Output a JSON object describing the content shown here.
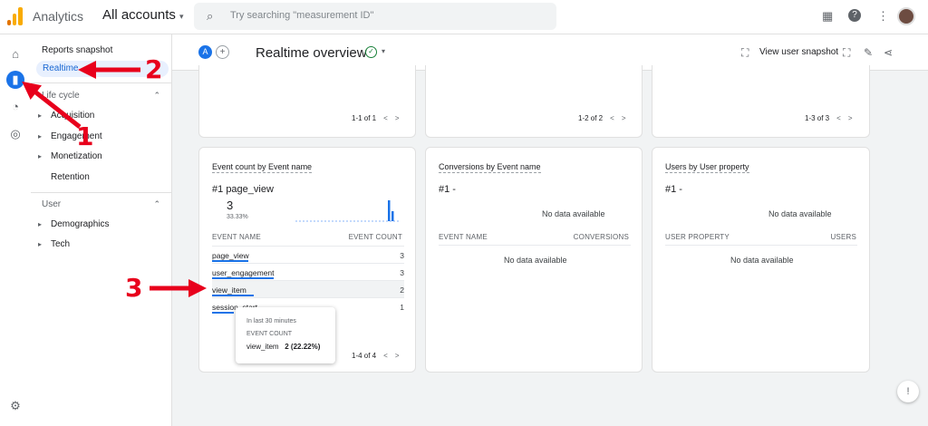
{
  "header": {
    "app_name": "Analytics",
    "accounts": "All accounts",
    "search_placeholder": "Try searching \"measurement ID\""
  },
  "sidebar": {
    "reports_snapshot": "Reports snapshot",
    "realtime": "Realtime",
    "life_cycle": "Life cycle",
    "life_cycle_items": [
      "Acquisition",
      "Engagement",
      "Monetization",
      "Retention"
    ],
    "user": "User",
    "user_items": [
      "Demographics",
      "Tech"
    ]
  },
  "toolbar": {
    "chip": "A",
    "title": "Realtime overview",
    "view_snapshot": "View user snapshot"
  },
  "top_cards": [
    {
      "pager": "1-1 of 1"
    },
    {
      "pager": "1-2 of 2"
    },
    {
      "pager": "1-3 of 3"
    }
  ],
  "event_card": {
    "title": "Event count by Event name",
    "top_rank": "#1",
    "top_name": "page_view",
    "top_value": "3",
    "top_pct": "33.33%",
    "col_name": "EVENT NAME",
    "col_value": "EVENT COUNT",
    "rows": [
      {
        "name": "page_view",
        "value": "3"
      },
      {
        "name": "user_engagement",
        "value": "3"
      },
      {
        "name": "view_item",
        "value": "2"
      },
      {
        "name": "session_start",
        "value": "1"
      }
    ],
    "pager": "1-4 of 4",
    "tooltip": {
      "period": "In last 30 minutes",
      "metric": "EVENT COUNT",
      "name": "view_item",
      "value": "2 (22.22%)"
    }
  },
  "conversions_card": {
    "title": "Conversions by Event name",
    "top_rank": "#1 -",
    "no_data": "No data available",
    "col_name": "EVENT NAME",
    "col_value": "CONVERSIONS",
    "table_no_data": "No data available"
  },
  "users_card": {
    "title": "Users by User property",
    "top_rank": "#1 -",
    "no_data": "No data available",
    "col_name": "USER PROPERTY",
    "col_value": "USERS",
    "table_no_data": "No data available"
  },
  "annotations": [
    "1",
    "2",
    "3"
  ],
  "colors": {
    "accent": "#1a73e8",
    "annotation": "#e8001c",
    "logo": "#f9ab00"
  }
}
